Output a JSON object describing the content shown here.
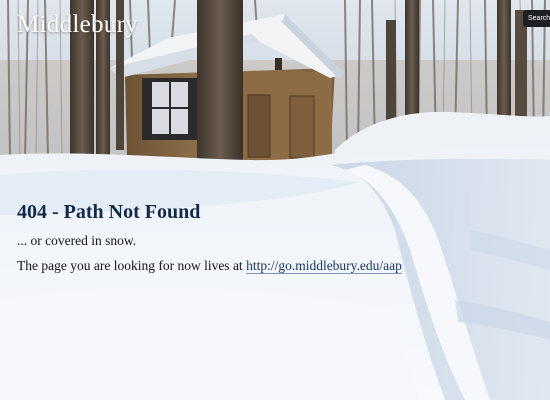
{
  "header": {
    "logo_text": "Middlebury",
    "search_label": "Search"
  },
  "error": {
    "title": "404 - Path Not Found",
    "subtitle": "... or covered in snow.",
    "message_prefix": "The page you are looking for now lives at ",
    "link_text": "http://go.middlebury.edu/aap"
  },
  "colors": {
    "title": "#122a4a",
    "link": "#16355f",
    "snow": "#f4f7fb",
    "snow_shadow": "#c9d5e6",
    "cabin_wood": "#8a6a45",
    "roof_snow": "#f2f3f5",
    "search_bg": "#1d1f22"
  },
  "icons": {
    "background": "snowy-forest-cabin-photo"
  }
}
